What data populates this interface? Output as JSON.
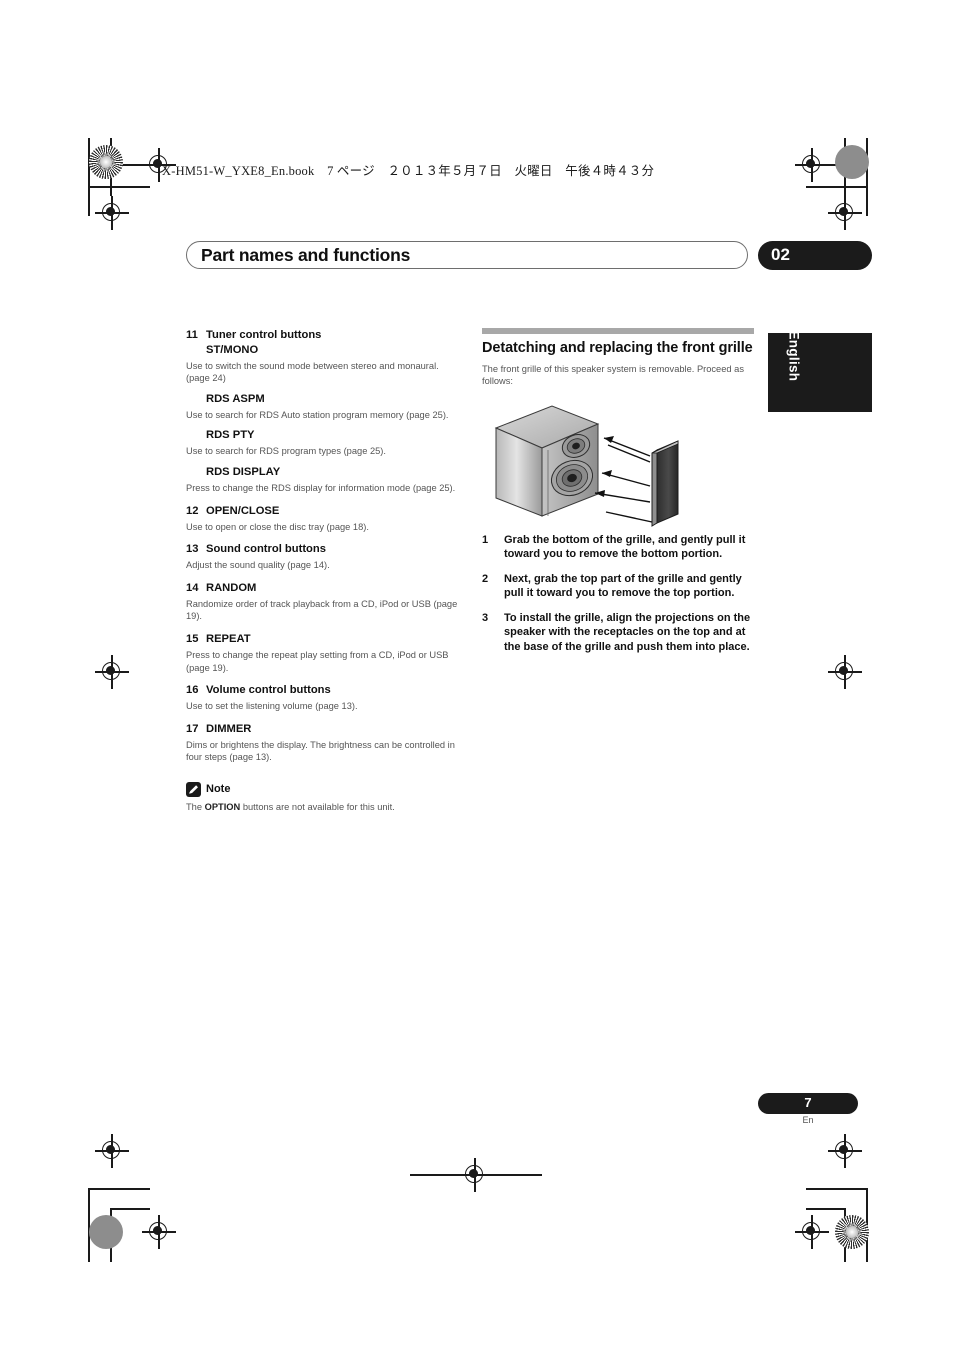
{
  "print": {
    "book_line": "X-HM51-W_YXE8_En.book　7 ページ　２０１３年５月７日　火曜日　午後４時４３分"
  },
  "header": {
    "title": "Part names and functions",
    "chapter": "02"
  },
  "side_tab": {
    "language": "English"
  },
  "left_column": {
    "items": [
      {
        "num": "11",
        "title": "Tuner control buttons",
        "subs": [
          {
            "label": "ST/MONO",
            "body": "Use to switch the sound mode between stereo and monaural. (page 24)"
          },
          {
            "label": "RDS ASPM",
            "body": "Use to search for RDS Auto station program memory (page 25)."
          },
          {
            "label": "RDS PTY",
            "body": "Use to search for RDS program types (page 25)."
          },
          {
            "label": "RDS DISPLAY",
            "body": "Press to change the RDS display for information mode (page 25)."
          }
        ]
      },
      {
        "num": "12",
        "title": "OPEN/CLOSE",
        "body": "Use to open or close the disc tray (page 18)."
      },
      {
        "num": "13",
        "title": "Sound control buttons",
        "body": "Adjust the sound quality (page 14)."
      },
      {
        "num": "14",
        "title": "RANDOM",
        "body": "Randomize order of track playback from a CD, iPod or USB (page 19)."
      },
      {
        "num": "15",
        "title": "REPEAT",
        "body": "Press to change the repeat play setting from a CD, iPod or USB (page 19)."
      },
      {
        "num": "16",
        "title": "Volume control buttons",
        "body": "Use to set the listening volume (page 13)."
      },
      {
        "num": "17",
        "title": "DIMMER",
        "body": "Dims or brightens the display. The brightness can be controlled in four steps (page 13)."
      }
    ],
    "note": {
      "label": "Note",
      "text_before": "The ",
      "text_bold": "OPTION",
      "text_after": " buttons are not available for this unit."
    }
  },
  "right_column": {
    "section_title": "Detatching and replacing the front grille",
    "intro": "The front grille of this speaker system is removable. Proceed as follows:",
    "steps": [
      {
        "num": "1",
        "text": "Grab the bottom of the grille, and gently pull it toward you to remove the bottom portion."
      },
      {
        "num": "2",
        "text": "Next, grab the top part of the grille and gently pull it toward you to remove the top portion."
      },
      {
        "num": "3",
        "text": "To install the grille, align the projections on the speaker with the receptacles on the top and at the base of the grille and push them into place."
      }
    ],
    "figure_caption": "speaker-grille-detach-illustration"
  },
  "footer": {
    "page_number": "7",
    "language_code": "En"
  },
  "colors": {
    "ink": "#1b1b1b",
    "body_text": "#555555",
    "rule": "#a8a8a8"
  }
}
